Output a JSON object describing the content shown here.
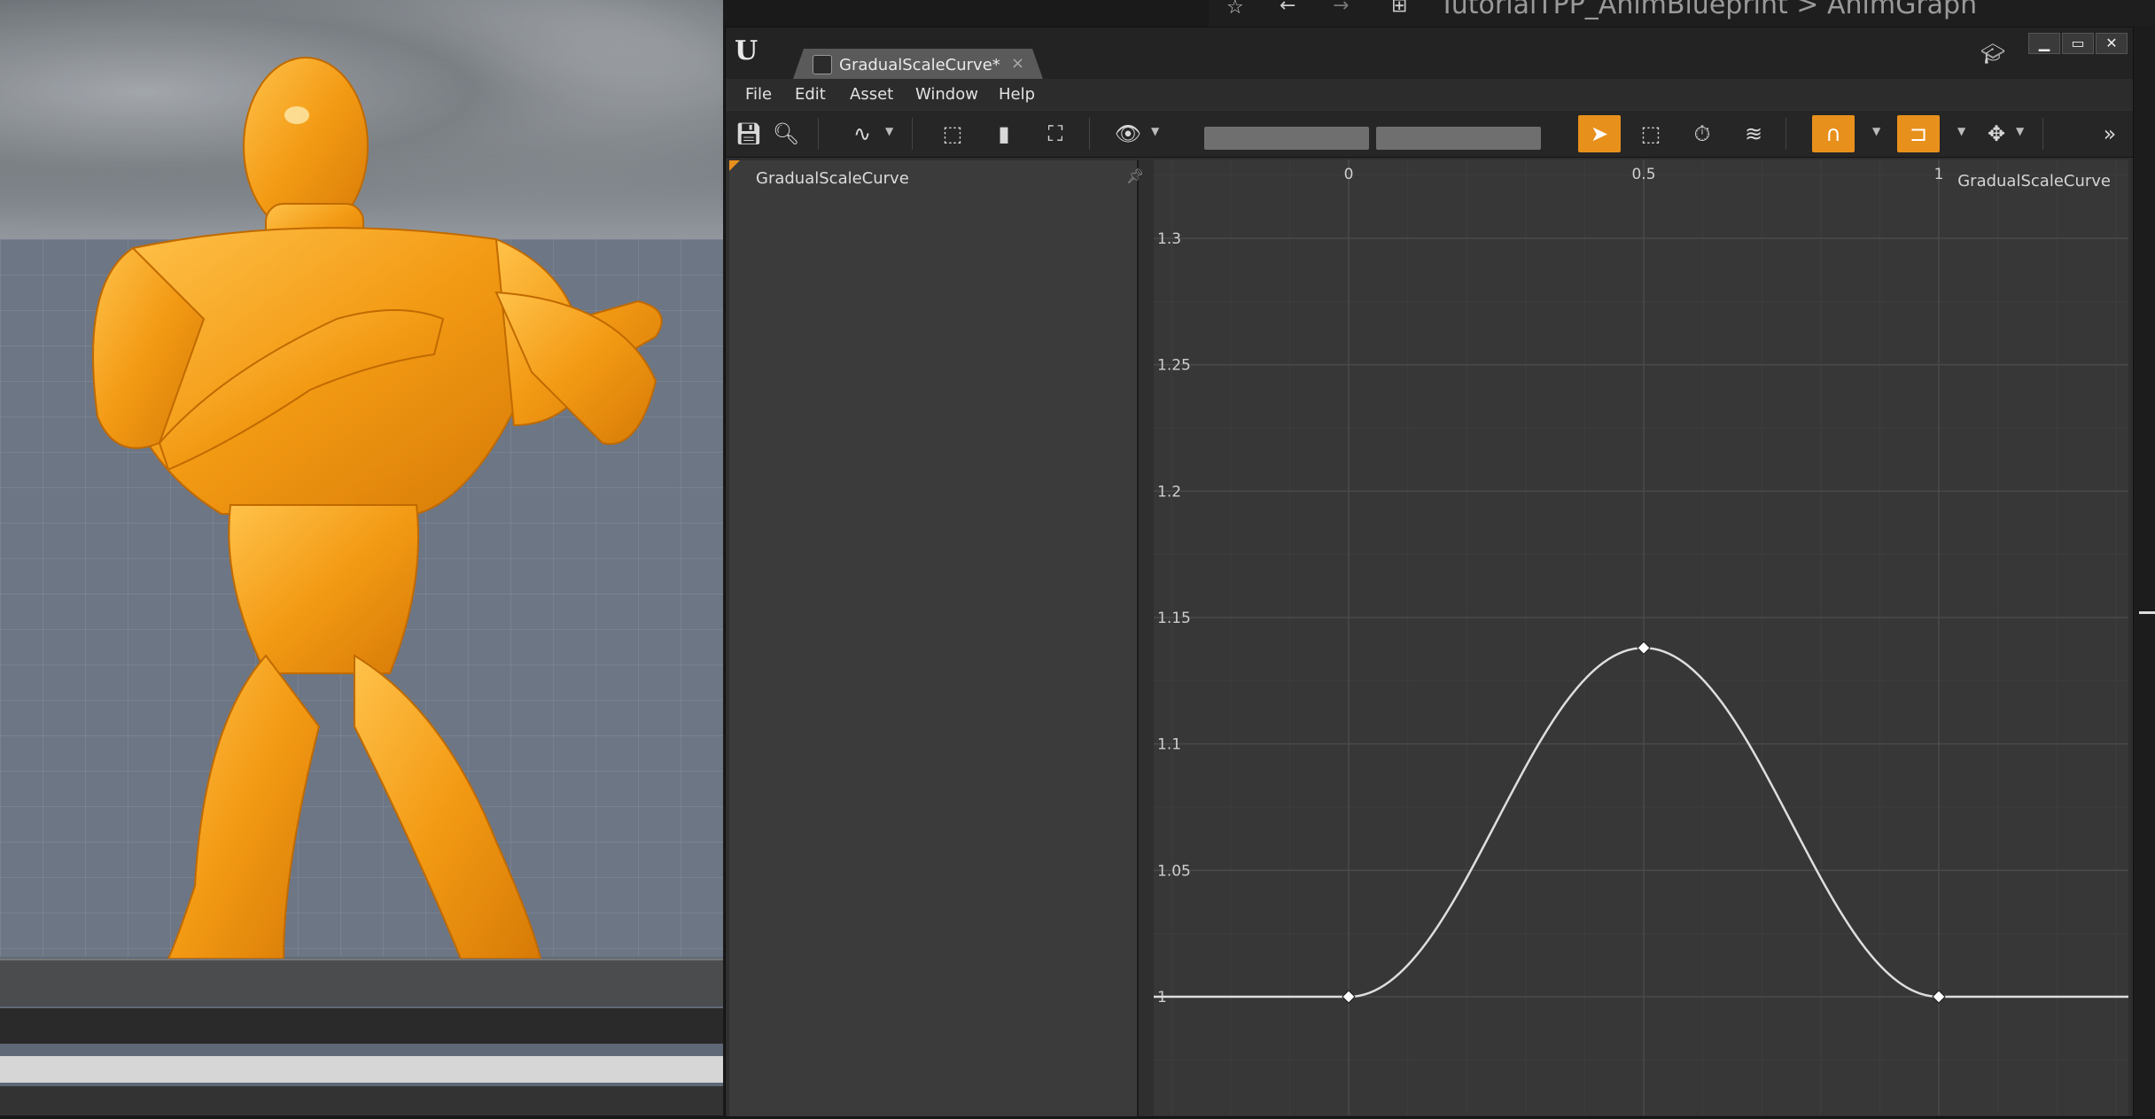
{
  "editor": {
    "tab_title": "GradualScaleCurve*",
    "tab_close": "×",
    "menu": [
      "File",
      "Edit",
      "Asset",
      "Window",
      "Help"
    ],
    "tree_item": "GradualScaleCurve",
    "graph_label": "GradualScaleCurve",
    "window_controls": [
      "▁",
      "▭",
      "✕"
    ]
  },
  "background_editor": {
    "breadcrumb": "TutorialTPP_AnimBlueprint > AnimGraph"
  },
  "toolbar": {
    "icons": [
      "save-icon",
      "browse-icon",
      "curve-type-icon",
      "frame-selection-icon",
      "key-icon",
      "fit-icon",
      "view-options-eye-icon",
      "select-icon",
      "transform-icon",
      "retime-icon",
      "multi-curve-icon",
      "snap-x-magnet-icon",
      "snap-y-icon",
      "move-icon",
      "expand-toolbar-icon"
    ],
    "accent_color": "#e8901c"
  },
  "chart_data": {
    "type": "line",
    "title": "",
    "series_label": "GradualScaleCurve",
    "x_ticks": [
      "0",
      "0.5",
      "1"
    ],
    "y_ticks": [
      "1",
      "1.05",
      "1.1",
      "1.15",
      "1.2",
      "1.25",
      "1.3"
    ],
    "xlim": [
      -0.33,
      1.3
    ],
    "ylim": [
      0.955,
      1.33
    ],
    "keys": [
      {
        "x": 0,
        "y": 1.0
      },
      {
        "x": 0.5,
        "y": 1.138
      },
      {
        "x": 1,
        "y": 1.0
      }
    ],
    "grid": true
  }
}
